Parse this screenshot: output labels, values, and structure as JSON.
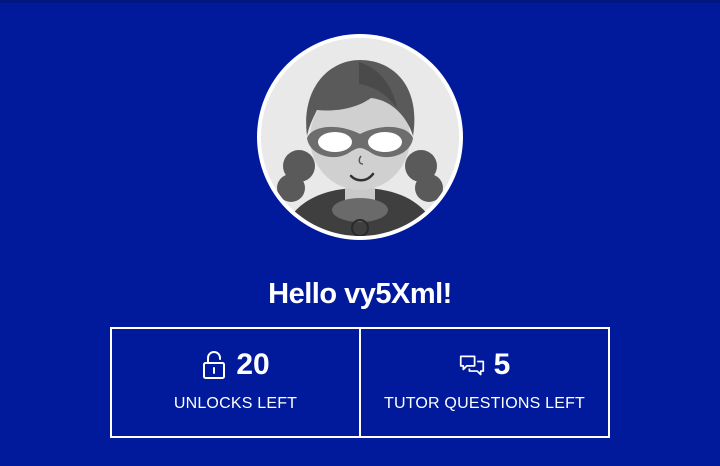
{
  "greeting": "Hello vy5Xml!",
  "profile": {
    "avatar_icon": "masked-hero-avatar-icon"
  },
  "stats": [
    {
      "icon": "unlock-icon",
      "value": "20",
      "label": "UNLOCKS LEFT"
    },
    {
      "icon": "chat-bubbles-icon",
      "value": "5",
      "label": "TUTOR QUESTIONS LEFT"
    }
  ],
  "colors": {
    "background": "#001a9b",
    "text": "#ffffff",
    "avatar_ring": "#ffffff"
  }
}
